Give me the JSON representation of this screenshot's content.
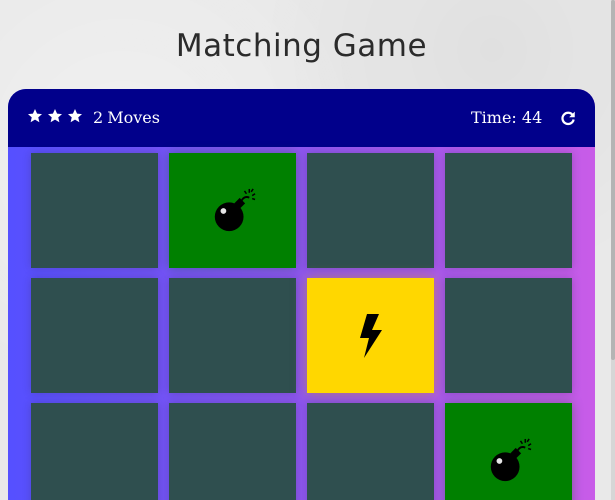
{
  "title": "Matching Game",
  "score_panel": {
    "stars": [
      "star-icon",
      "star-icon",
      "star-icon"
    ],
    "moves_count": "2",
    "moves_label": "Moves",
    "timer_label": "Time:",
    "timer_value": "44",
    "restart_icon": "refresh-icon"
  },
  "deck": {
    "cards": [
      {
        "state": "closed",
        "icon": ""
      },
      {
        "state": "match",
        "icon": "bomb-icon"
      },
      {
        "state": "closed",
        "icon": ""
      },
      {
        "state": "closed",
        "icon": ""
      },
      {
        "state": "closed",
        "icon": ""
      },
      {
        "state": "closed",
        "icon": ""
      },
      {
        "state": "open",
        "icon": "bolt-icon"
      },
      {
        "state": "closed",
        "icon": ""
      },
      {
        "state": "closed",
        "icon": ""
      },
      {
        "state": "closed",
        "icon": ""
      },
      {
        "state": "closed",
        "icon": ""
      },
      {
        "state": "match",
        "icon": "bomb-icon"
      }
    ]
  },
  "colors": {
    "score_panel_bg": "#01008b",
    "card_closed": "#2f4f4f",
    "card_match": "#008000",
    "card_open": "#ffd700",
    "deck_gradient_start": "#5550ff",
    "deck_gradient_end": "#c85ce8"
  }
}
